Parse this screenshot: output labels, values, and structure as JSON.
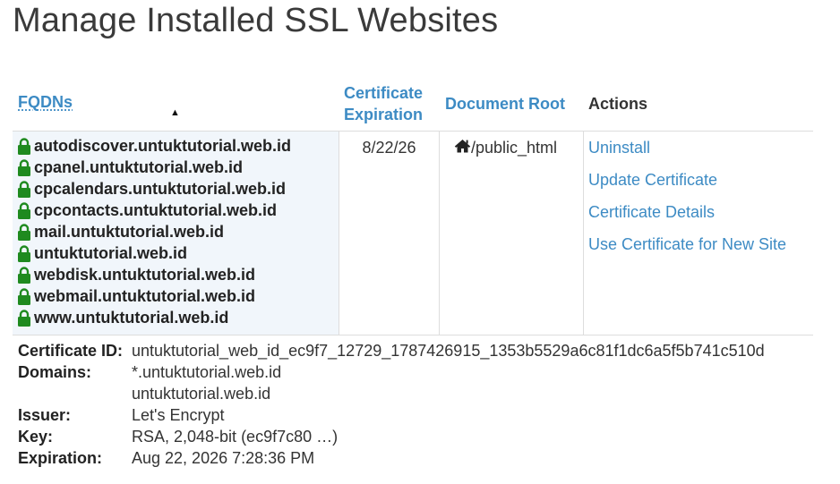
{
  "page": {
    "title": "Manage Installed SSL Websites"
  },
  "table": {
    "headers": {
      "fqdns": "FQDNs",
      "cert_expiration_line1": "Certificate",
      "cert_expiration_line2": "Expiration",
      "document_root": "Document Root",
      "actions": "Actions"
    },
    "sort_indicator": "▲",
    "row": {
      "fqdns": [
        "autodiscover.untuktutorial.web.id",
        "cpanel.untuktutorial.web.id",
        "cpcalendars.untuktutorial.web.id",
        "cpcontacts.untuktutorial.web.id",
        "mail.untuktutorial.web.id",
        "untuktutorial.web.id",
        "webdisk.untuktutorial.web.id",
        "webmail.untuktutorial.web.id",
        "www.untuktutorial.web.id"
      ],
      "expiration": "8/22/26",
      "document_root": "/public_html",
      "actions": [
        "Uninstall",
        "Update Certificate",
        "Certificate Details",
        "Use Certificate for New Site"
      ]
    }
  },
  "details": {
    "certificate_id_label": "Certificate ID:",
    "certificate_id": "untuktutorial_web_id_ec9f7_12729_1787426915_1353b5529a6c81f1dc6a5f5b741c510d",
    "domains_label": "Domains:",
    "domains": [
      "*.untuktutorial.web.id",
      "untuktutorial.web.id"
    ],
    "issuer_label": "Issuer:",
    "issuer": "Let's Encrypt",
    "key_label": "Key:",
    "key": "RSA, 2,048-bit (ec9f7c80 …)",
    "expiration_label": "Expiration:",
    "expiration": "Aug 22, 2026 7:28:36 PM"
  },
  "icons": {
    "lock": "lock-icon",
    "home": "home-icon"
  },
  "colors": {
    "link": "#3d8bc4",
    "lock": "#1f8a1f",
    "row_highlight": "#f1f6fb"
  }
}
